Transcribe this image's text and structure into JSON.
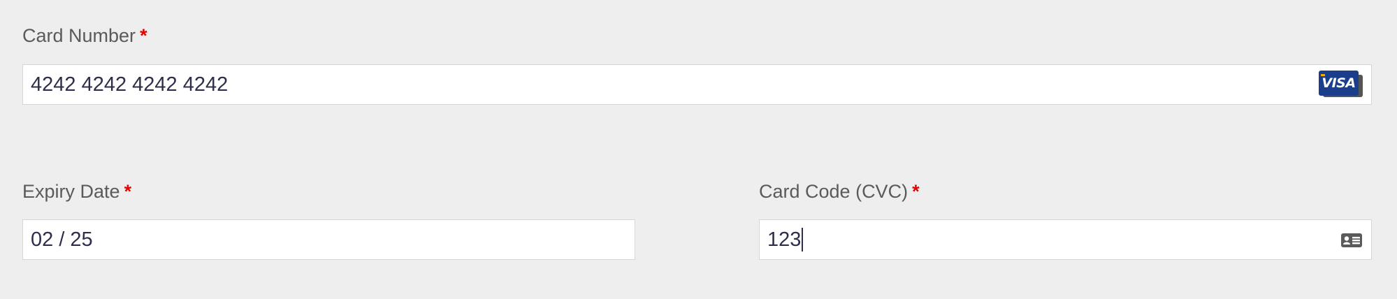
{
  "card_number": {
    "label": "Card Number",
    "required_mark": "*",
    "value": "4242 4242 4242 4242",
    "brand_label": "VISA",
    "brand_icon": "visa-card-icon"
  },
  "expiry": {
    "label": "Expiry Date",
    "required_mark": "*",
    "value": "02 / 25"
  },
  "cvc": {
    "label": "Card Code (CVC)",
    "required_mark": "*",
    "value": "123",
    "icon": "id-card-icon"
  },
  "colors": {
    "background": "#eeeeee",
    "required": "#e60000",
    "input_text": "#2e2e4a",
    "visa_blue": "#1a3e8c"
  }
}
